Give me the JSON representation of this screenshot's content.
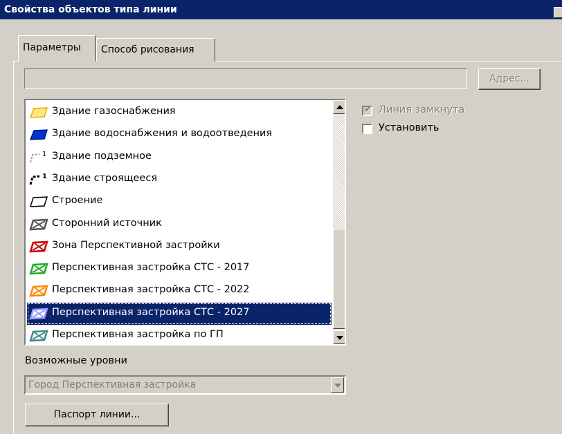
{
  "window": {
    "title": "Свойства объектов типа линии"
  },
  "tabs": [
    {
      "label": "Параметры",
      "active": true
    },
    {
      "label": "Способ рисования",
      "active": false
    }
  ],
  "path_field": {
    "value": ""
  },
  "address_button": {
    "label": "Адрес...",
    "enabled": false
  },
  "line_types": [
    {
      "label": "Здание газоснабжения",
      "icon": "gas-supply-building-icon",
      "color": "#ffe680"
    },
    {
      "label": "Здание водоснабжения и водоотведения",
      "icon": "water-supply-building-icon",
      "color": "#0033cc"
    },
    {
      "label": "Здание подземное",
      "icon": "underground-building-icon",
      "color": "#999999"
    },
    {
      "label": "Здание строящееся",
      "icon": "building-under-construction-icon",
      "color": "#000000"
    },
    {
      "label": "Строение",
      "icon": "structure-icon",
      "color": "#000000"
    },
    {
      "label": "Сторонний источник",
      "icon": "third-party-source-icon",
      "color": "#555555"
    },
    {
      "label": "Зона Перспективной застройки",
      "icon": "perspective-zone-icon",
      "color": "#cc0000"
    },
    {
      "label": "Перспективная застройка СТС - 2017",
      "icon": "perspective-2017-icon",
      "color": "#22aa22"
    },
    {
      "label": "Перспективная застройка СТС - 2022",
      "icon": "perspective-2022-icon",
      "color": "#ff8800"
    },
    {
      "label": "Перспективная застройка СТС - 2027",
      "icon": "perspective-2027-icon",
      "color": "#9999ff",
      "selected": true
    },
    {
      "label": "Перспективная застройка по ГП",
      "icon": "perspective-gp-icon",
      "color": "#448888"
    }
  ],
  "options": {
    "closed_line": {
      "label": "Линия замкнута",
      "checked": true,
      "enabled": false
    },
    "set": {
      "label": "Установить",
      "checked": false,
      "enabled": true
    }
  },
  "levels": {
    "label": "Возможные уровни",
    "value": "Город Перспективная застройка",
    "enabled": false
  },
  "passport_button": {
    "label": "Паспорт линии..."
  }
}
